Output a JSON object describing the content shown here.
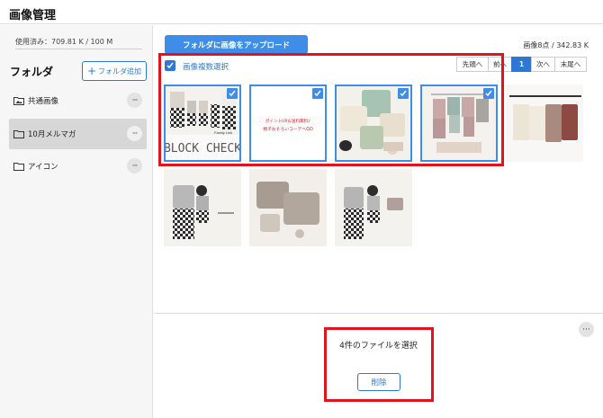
{
  "header": {
    "title": "画像管理"
  },
  "sidebar": {
    "usage": "使用済み：709.81 K / 100 M",
    "folders_title": "フォルダ",
    "add_folder_label": "フォルダ追加",
    "folders": [
      {
        "label": "共通画像",
        "icon": "folder-image-icon",
        "active": false
      },
      {
        "label": "10月メルマガ",
        "icon": "folder-icon",
        "active": true
      },
      {
        "label": "アイコン",
        "icon": "folder-icon",
        "active": false
      }
    ]
  },
  "main": {
    "upload_label": "フォルダに画像をアップロード",
    "count_text": "画像8点 / 342.83 K",
    "multi_select_label": "画像複数選択",
    "pager": {
      "first": "先頭へ",
      "prev": "前へ",
      "current": "1",
      "next": "次へ",
      "last": "末尾へ"
    },
    "thumbnails": [
      {
        "name": "block-check-outfit",
        "selected": true,
        "caption": "BLOCK CHECK",
        "small_label": "Family Link"
      },
      {
        "name": "text-banner",
        "selected": true,
        "line1": "ポイントUP＆送料無料♪",
        "line2": "親子おそろいコーデへGO"
      },
      {
        "name": "sweater-collage",
        "selected": true
      },
      {
        "name": "pink-sets",
        "selected": true
      },
      {
        "name": "knits-on-rack",
        "selected": false
      },
      {
        "name": "mannequin-checks",
        "selected": false
      },
      {
        "name": "parent-child-sweatshirts",
        "selected": false
      },
      {
        "name": "mannequin-checks-2",
        "selected": false
      }
    ]
  },
  "footer": {
    "selected_text": "4件のファイルを選択",
    "delete_label": "削除"
  },
  "colors": {
    "accent": "#2d78d5",
    "button": "#3e8ee9",
    "highlight": "#e0141d"
  }
}
